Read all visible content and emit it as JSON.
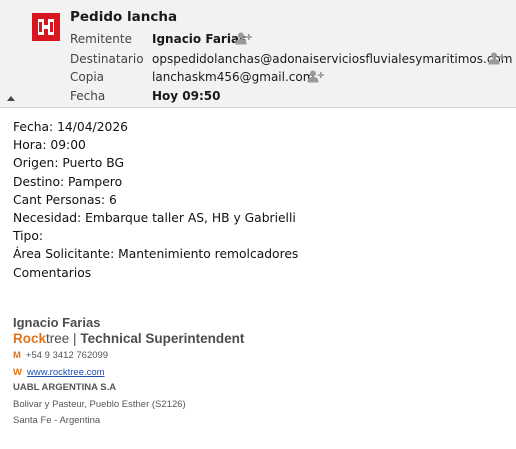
{
  "header": {
    "subject": "Pedido lancha",
    "fields": [
      {
        "label": "Remitente",
        "value": "Ignacio Farias"
      },
      {
        "label": "Destinatario",
        "value": "opspedidolanchas@adonaiserviciosfluvialesymaritimos.com"
      },
      {
        "label": "Copia",
        "value": "lanchaskm456@gmail.com"
      },
      {
        "label": "Fecha",
        "value": "Hoy 09:50"
      }
    ],
    "icons": {
      "logo": "app-logo-icon",
      "add_contact": "add-contact-icon",
      "collapse": "collapse-arrow-icon"
    },
    "colors": {
      "logo_red": "#d8161f",
      "header_bg": "#f2f2f2"
    }
  },
  "body": {
    "lines": [
      "Fecha: 14/04/2026",
      "Hora: 09:00",
      "Origen: Puerto BG",
      "Destino: Pampero",
      "Cant Personas: 6",
      "Necesidad: Embarque taller AS, HB y Gabrielli",
      "Tipo:",
      "Área Solicitante: Mantenimiento remolcadores",
      "Comentarios"
    ]
  },
  "signature": {
    "name": "Ignacio Farias",
    "brand_rock": "Rock",
    "brand_tree": "tree",
    "separator": "|",
    "title": "Technical Superintendent",
    "phone_key": "M",
    "phone": "+54 9 3412 762099",
    "web_key": "W",
    "web": "www.rocktree.com",
    "org": "UABL ARGENTINA S.A",
    "address": "Bolivar y Pasteur, Pueblo Esther (S2126)",
    "city": "Santa Fe - Argentina",
    "colors": {
      "brand_orange": "#e2731b",
      "link_blue": "#1f4fb2"
    }
  }
}
